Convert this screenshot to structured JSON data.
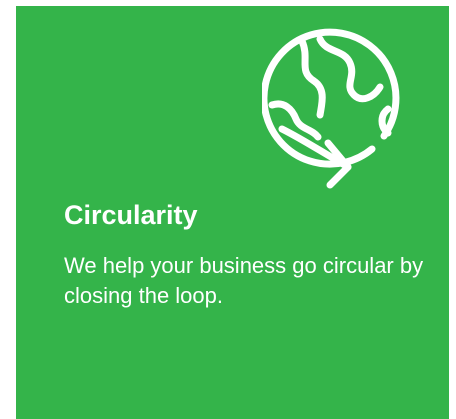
{
  "card": {
    "title": "Circularity",
    "description": "We help your business go circular by closing the loop.",
    "icon": "globe-arrow-icon",
    "background_color": "#34b44a",
    "text_color": "#ffffff"
  }
}
